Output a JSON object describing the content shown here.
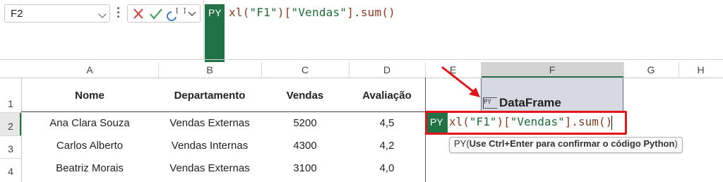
{
  "formula_bar": {
    "name_box": "F2",
    "py_badge": "PY",
    "formula_tokens": [
      {
        "text": "xl(",
        "kind": "plain"
      },
      {
        "text": "\"F1\"",
        "kind": "str"
      },
      {
        "text": ")[",
        "kind": "plain"
      },
      {
        "text": "\"Vendas\"",
        "kind": "str"
      },
      {
        "text": "].sum()",
        "kind": "plain"
      }
    ]
  },
  "columns": [
    "A",
    "B",
    "C",
    "D",
    "E",
    "F",
    "G",
    "H"
  ],
  "rows": [
    "1",
    "2",
    "3",
    "4"
  ],
  "table": {
    "headers": [
      "Nome",
      "Departamento",
      "Vendas",
      "Avaliação"
    ],
    "data": [
      [
        "Ana Clara Souza",
        "Vendas Externas",
        "5200",
        "4,5"
      ],
      [
        "Carlos Alberto",
        "Vendas Internas",
        "4300",
        "4,2"
      ],
      [
        "Beatriz Morais",
        "Vendas Externas",
        "3100",
        "4,0"
      ]
    ]
  },
  "dataframe_cell": {
    "icon_text": "PY",
    "label": "DataFrame"
  },
  "edit_cell": {
    "py_badge": "PY",
    "formula_tokens": [
      {
        "text": "xl(",
        "kind": "plain"
      },
      {
        "text": "\"F1\"",
        "kind": "str"
      },
      {
        "text": ")[",
        "kind": "plain"
      },
      {
        "text": "\"Vendas\"",
        "kind": "str"
      },
      {
        "text": "].sum()",
        "kind": "plain"
      }
    ]
  },
  "tooltip": {
    "prefix": "PY(",
    "bold": "Use Ctrl+Enter para confirmar o código Python",
    "suffix": ")"
  },
  "colors": {
    "python_green": "#217346",
    "highlight_red": "#e1161c",
    "string_green": "#1a6b35",
    "plain_brown": "#8a3b1f"
  }
}
